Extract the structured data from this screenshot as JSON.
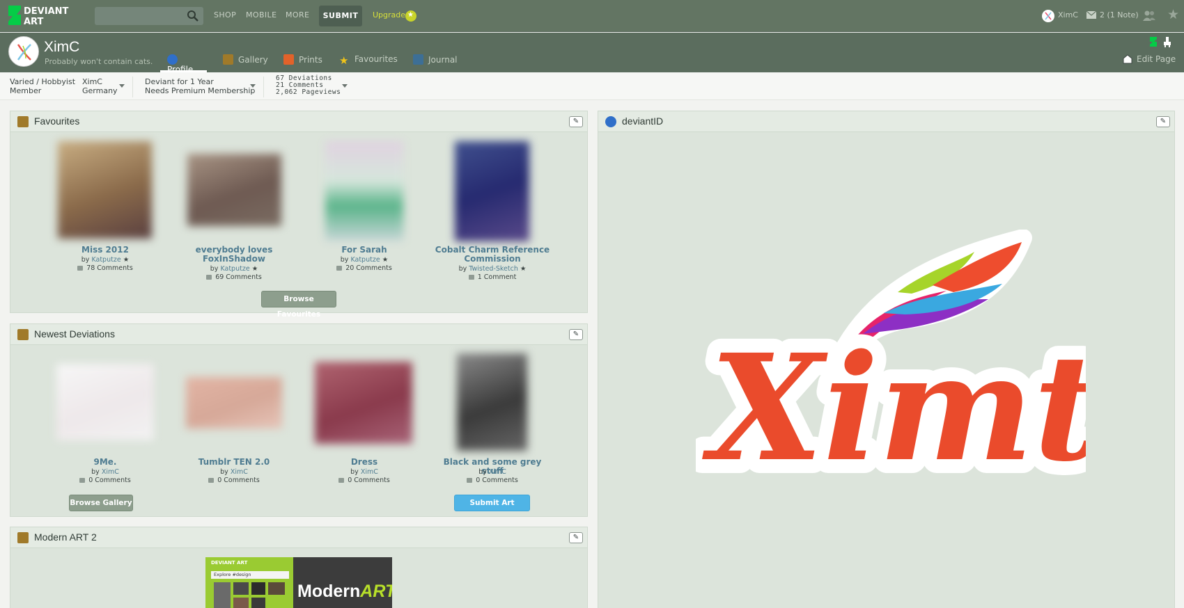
{
  "topbar": {
    "logo_text": "DEVIANT ART",
    "search_placeholder": "",
    "nav": [
      "SHOP",
      "MOBILE",
      "MORE"
    ],
    "submit_label": "SUBMIT",
    "upgrade_label": "Upgrade",
    "username": "XimC",
    "notifications": "2 (1 Note)"
  },
  "profile": {
    "username": "XimC",
    "tagline": "Probably won't contain cats.",
    "tabs": [
      "Profile",
      "Gallery",
      "Prints",
      "Favourites",
      "Journal"
    ],
    "active_tab": "Profile",
    "edit_page_label": "Edit Page"
  },
  "stats": {
    "member_type_line1": "Varied / Hobbyist",
    "member_type_line2": "Member",
    "name": "XimC",
    "country": "Germany",
    "deviant_for": "Deviant for 1 Year",
    "membership": "Needs Premium Membership",
    "deviations": "67 Deviations",
    "comments": "21 Comments",
    "pageviews": "2,062 Pageviews"
  },
  "favourites": {
    "title": "Favourites",
    "items": [
      {
        "title": "Miss 2012",
        "by": "by",
        "author": "Katputze",
        "comments": "78 Comments"
      },
      {
        "title": "everybody loves FoxInShadow",
        "by": "by",
        "author": "Katputze",
        "comments": "69 Comments"
      },
      {
        "title": "For Sarah",
        "by": "by",
        "author": "Katputze",
        "comments": "20 Comments"
      },
      {
        "title": "Cobalt Charm Reference Commission",
        "by": "by",
        "author": "Twisted-Sketch",
        "comments": "1 Comment"
      }
    ],
    "browse_label": "Browse Favourites"
  },
  "newest": {
    "title": "Newest Deviations",
    "items": [
      {
        "title": "9Me.",
        "by": "by",
        "author": "XimC",
        "comments": "0 Comments"
      },
      {
        "title": "Tumblr TEN 2.0",
        "by": "by",
        "author": "XimC",
        "comments": "0 Comments"
      },
      {
        "title": "Dress",
        "by": "by",
        "author": "XimC",
        "comments": "0 Comments"
      },
      {
        "title": "Black and some grey stuff",
        "by": "by",
        "author": "XimC",
        "comments": "0 Comments"
      }
    ],
    "browse_label": "Browse Gallery",
    "submit_label": "Submit Art"
  },
  "modern": {
    "title": "Modern ART 2",
    "preview_header": "DEVIANT ART",
    "preview_search_text": "Explore #design",
    "preview_text": "Modern",
    "preview_text_accent": "ART"
  },
  "deviantid": {
    "title": "deviantID",
    "logo_text": "Ximts"
  },
  "colors": {
    "topbar": "#637563",
    "profilebar": "#5b6d5e",
    "panel": "#dce4db",
    "link": "#4f7c91",
    "submit_blue": "#4fb4e6"
  }
}
